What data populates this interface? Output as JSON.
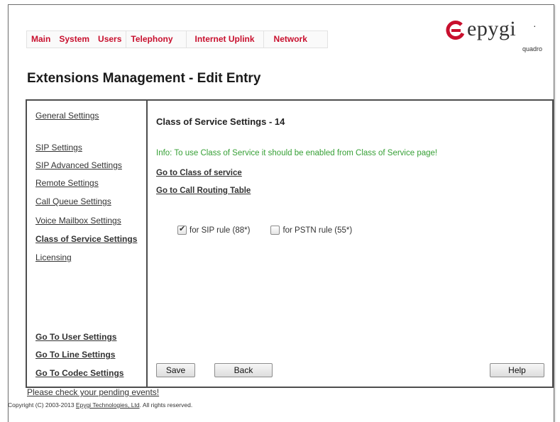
{
  "nav": {
    "items": [
      "Main",
      "System",
      "Users",
      "Telephony",
      "Internet Uplink",
      "Network"
    ]
  },
  "logo": {
    "wordmark": "epygi",
    "sub": "quadro",
    "color": "#c8102e"
  },
  "page_title": "Extensions Management - Edit Entry",
  "sidebar": {
    "links": [
      "General Settings",
      "SIP Settings",
      "SIP Advanced Settings",
      "Remote Settings",
      "Call Queue Settings",
      "Voice Mailbox Settings",
      "Class of Service Settings",
      "Licensing"
    ],
    "bottom_links": [
      "Go To User Settings",
      "Go To Line Settings",
      "Go To Codec Settings"
    ]
  },
  "content": {
    "heading": "Class of Service Settings - 14",
    "info": "Info: To use Class of Service it should be enabled from Class of Service page!",
    "link_cos": "Go to Class of service",
    "link_routing": "Go to Call Routing Table",
    "checkboxes": [
      {
        "label": "for SIP rule (88*)",
        "checked": true
      },
      {
        "label": "for PSTN rule (55*)",
        "checked": false
      }
    ]
  },
  "buttons": {
    "save": "Save",
    "back": "Back",
    "help": "Help"
  },
  "footer": {
    "pending": "Please check your pending events!",
    "copyright_prefix": "Copyright (C) 2003-2013 ",
    "company": "Epygi Technologies, Ltd",
    "copyright_suffix": ". All rights reserved."
  }
}
